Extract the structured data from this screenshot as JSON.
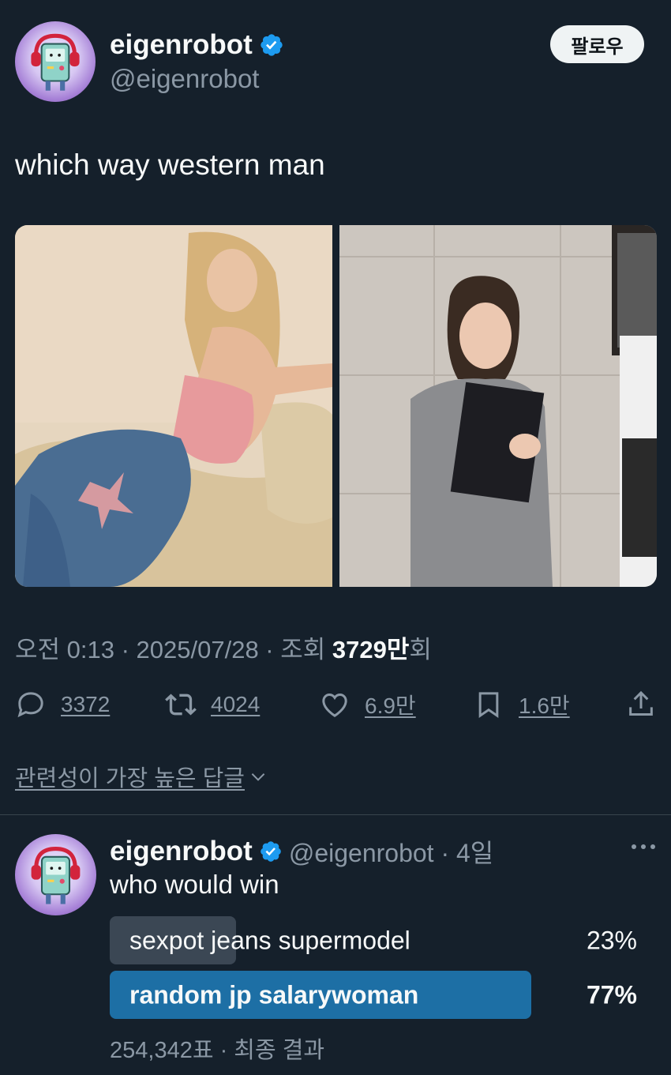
{
  "tweet": {
    "author": {
      "display_name": "eigenrobot",
      "handle": "@eigenrobot",
      "verified": true
    },
    "follow_label": "팔로우",
    "text": "which way western man",
    "timestamp": "오전 0:13 · 2025/07/28 · 조회 ",
    "views_count": "3729만",
    "views_suffix": "회",
    "stats": {
      "replies": "3372",
      "retweets": "4024",
      "likes": "6.9만",
      "bookmarks": "1.6만"
    }
  },
  "replies_sort_label": "관련성이 가장 높은 답글",
  "reply": {
    "display_name": "eigenrobot",
    "handle_time": "@eigenrobot · 4일",
    "text": "who would win",
    "poll": {
      "options": [
        {
          "label": "sexpot jeans supermodel",
          "percent": "23%",
          "fraction": 0.23,
          "winner": false
        },
        {
          "label": "random jp salarywoman",
          "percent": "77%",
          "fraction": 0.77,
          "winner": true
        }
      ],
      "footer": "254,342표 · 최종 결과"
    }
  },
  "colors": {
    "background": "#15202b",
    "text_primary": "#f7f9f9",
    "text_secondary": "#8b98a5",
    "verified_blue": "#1d9bf0",
    "poll_winner": "#1d6fa5",
    "poll_other": "#3b4754"
  },
  "icons": [
    "verified-badge-icon",
    "reply-icon",
    "retweet-icon",
    "like-icon",
    "bookmark-icon",
    "share-icon",
    "chevron-down-icon",
    "more-icon"
  ]
}
